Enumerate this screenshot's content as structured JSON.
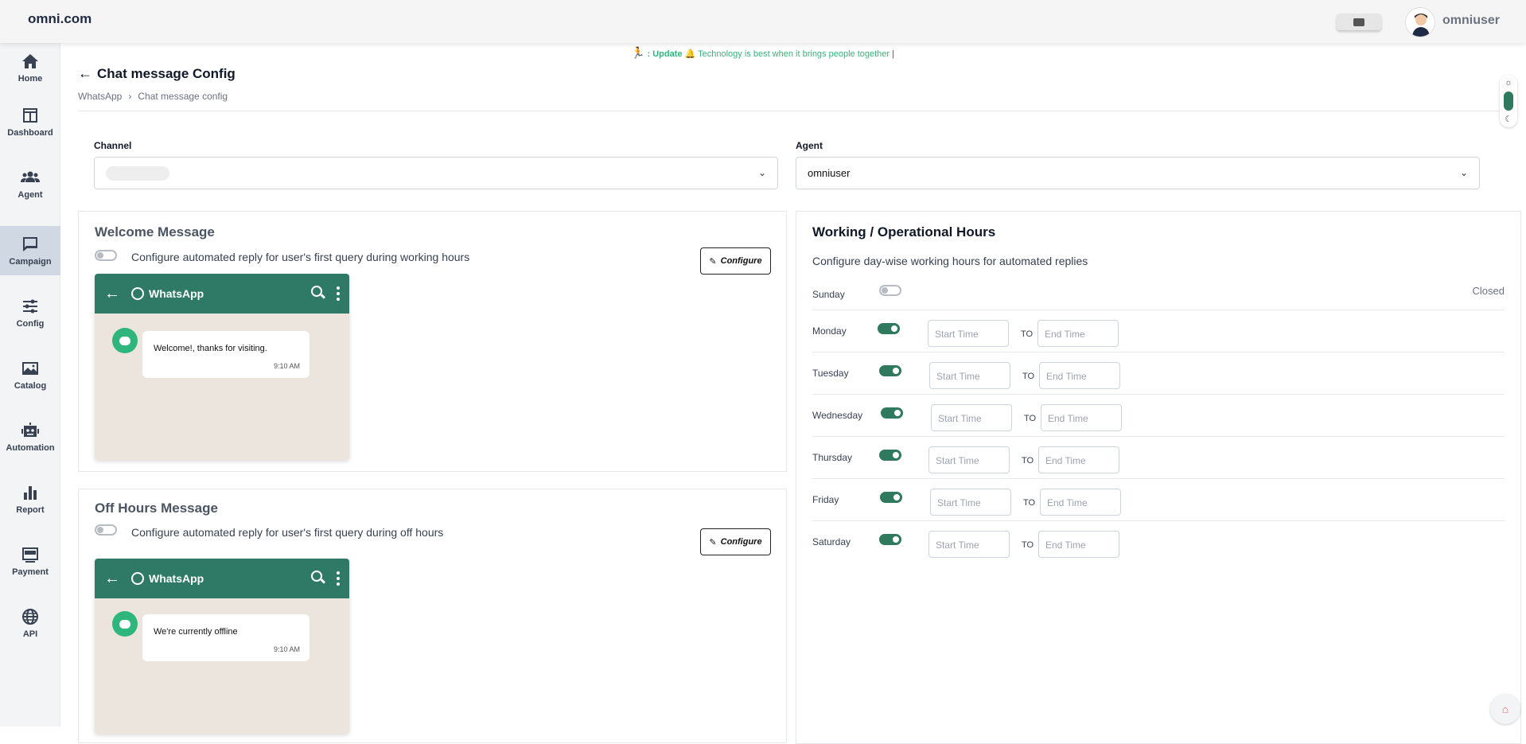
{
  "header": {
    "brand": "omni.com",
    "username": "omniuser"
  },
  "sidebar": {
    "items": [
      {
        "label": "Home",
        "icon": "home-icon"
      },
      {
        "label": "Dashboard",
        "icon": "dashboard-icon"
      },
      {
        "label": "Agent",
        "icon": "users-icon"
      },
      {
        "label": "Campaign",
        "icon": "chat-icon",
        "active": true
      },
      {
        "label": "Config",
        "icon": "sliders-icon"
      },
      {
        "label": "Catalog",
        "icon": "image-icon"
      },
      {
        "label": "Automation",
        "icon": "robot-icon"
      },
      {
        "label": "Report",
        "icon": "bar-chart-icon"
      },
      {
        "label": "Payment",
        "icon": "pay-icon"
      },
      {
        "label": "API",
        "icon": "globe-icon"
      }
    ]
  },
  "ticker": {
    "prefix": ": Update",
    "text": "Technology is best when it brings people together"
  },
  "page": {
    "title": "Chat message Config",
    "breadcrumb": [
      "WhatsApp",
      "Chat message config"
    ]
  },
  "filters": {
    "channel_label": "Channel",
    "agent_label": "Agent",
    "agent_value": "omniuser"
  },
  "welcome": {
    "title": "Welcome Message",
    "description": "Configure automated reply for user's first query during working hours",
    "button": "Configure",
    "preview_title": "WhatsApp",
    "message": "Welcome!, thanks for visiting.",
    "time": "9:10 AM"
  },
  "offhours": {
    "title": "Off Hours Message",
    "description": "Configure automated reply for user's first query during off hours",
    "button": "Configure",
    "preview_title": "WhatsApp",
    "message": "We're currently offline",
    "time": "9:10 AM"
  },
  "working_hours": {
    "title": "Working / Operational Hours",
    "description": "Configure day-wise working hours for automated replies",
    "start_placeholder": "Start Time",
    "end_placeholder": "End Time",
    "to_label": "TO",
    "closed_label": "Closed",
    "days": [
      {
        "name": "Sunday",
        "enabled": false
      },
      {
        "name": "Monday",
        "enabled": true
      },
      {
        "name": "Tuesday",
        "enabled": true
      },
      {
        "name": "Wednesday",
        "enabled": true
      },
      {
        "name": "Thursday",
        "enabled": true
      },
      {
        "name": "Friday",
        "enabled": true
      },
      {
        "name": "Saturday",
        "enabled": true
      }
    ]
  },
  "colors": {
    "accent": "#2f7a66",
    "ticker": "#2eb67d"
  }
}
